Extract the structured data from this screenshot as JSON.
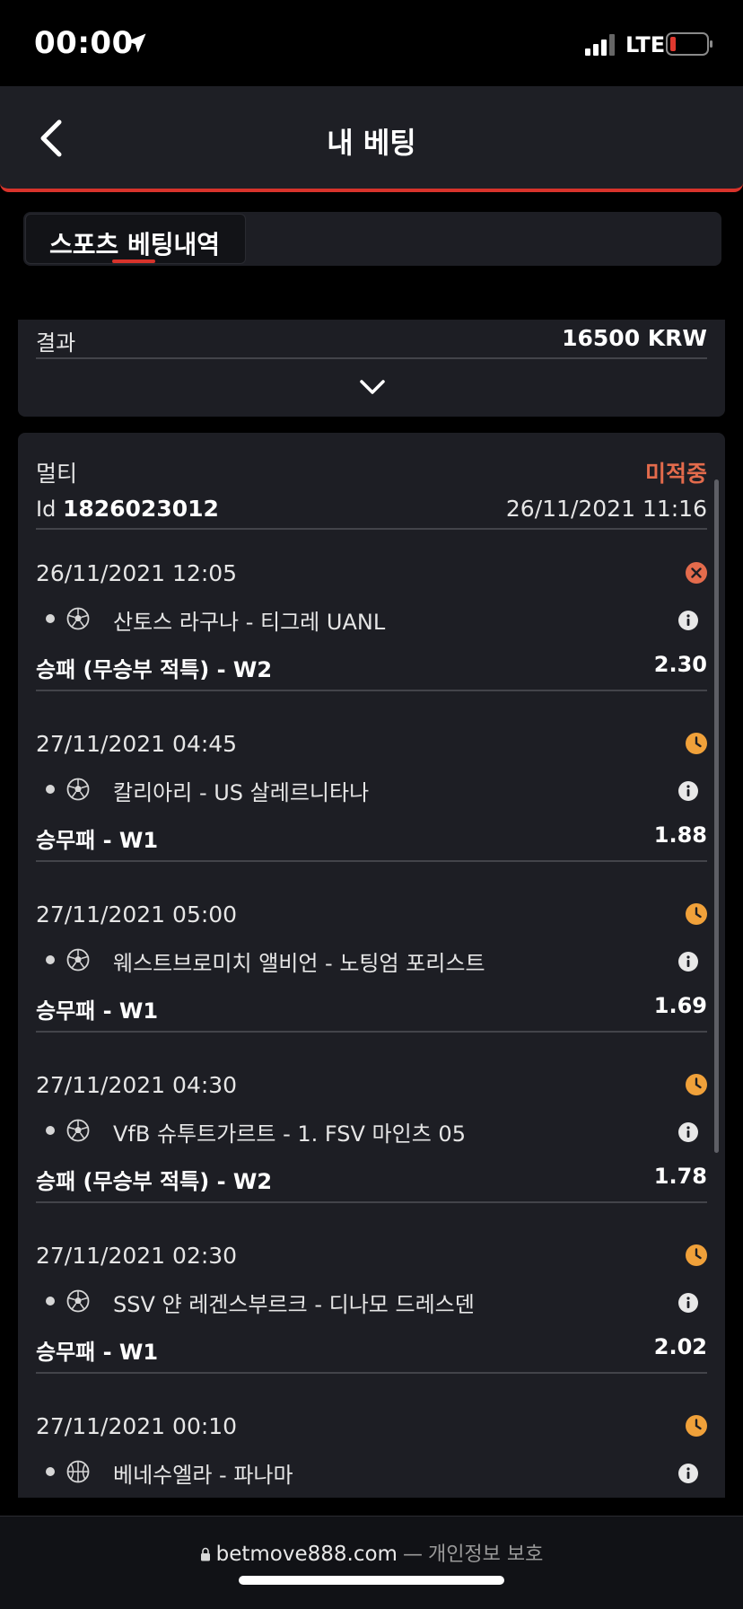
{
  "status_bar": {
    "time": "00:00",
    "network": "LTE",
    "icons": [
      "location-arrow-icon",
      "signal-icon",
      "battery-icon"
    ]
  },
  "header": {
    "title": "내 베팅",
    "icons": [
      "back-chevron-icon"
    ]
  },
  "tabs": [
    {
      "label": "스포츠 베팅내역",
      "active": true
    }
  ],
  "summary": {
    "label": "결과",
    "value": "16500 KRW",
    "icons": [
      "chevron-down-icon"
    ]
  },
  "bet": {
    "type": "멀티",
    "status": "미적중",
    "id_label": "Id",
    "id": "1826023012",
    "date": "26/11/2021 11:16",
    "events": [
      {
        "time": "26/11/2021 12:05",
        "status_icon": "lost-x-icon",
        "sport_icon": "soccer-ball-icon",
        "match": "산토스 라구나 - 티그레 UANL",
        "market": "승패 (무승부 적특) - W2",
        "odds": "2.30"
      },
      {
        "time": "27/11/2021 04:45",
        "status_icon": "pending-clock-icon",
        "sport_icon": "soccer-ball-icon",
        "match": "칼리아리 - US 살레르니타나",
        "market": "승무패 - W1",
        "odds": "1.88"
      },
      {
        "time": "27/11/2021 05:00",
        "status_icon": "pending-clock-icon",
        "sport_icon": "soccer-ball-icon",
        "match": "웨스트브로미치 앨비언 - 노팅엄 포리스트",
        "market": "승무패 - W1",
        "odds": "1.69"
      },
      {
        "time": "27/11/2021 04:30",
        "status_icon": "pending-clock-icon",
        "sport_icon": "soccer-ball-icon",
        "match": "VfB 슈투트가르트 - 1. FSV 마인츠 05",
        "market": "승패 (무승부 적특) - W2",
        "odds": "1.78"
      },
      {
        "time": "27/11/2021 02:30",
        "status_icon": "pending-clock-icon",
        "sport_icon": "soccer-ball-icon",
        "match": "SSV 얀 레겐스부르크 - 디나모 드레스덴",
        "market": "승무패 - W1",
        "odds": "2.02"
      },
      {
        "time": "27/11/2021 00:10",
        "status_icon": "pending-clock-icon",
        "sport_icon": "basketball-icon",
        "match": "베네수엘라 - 파나마",
        "market": "",
        "odds": ""
      }
    ]
  },
  "footer": {
    "domain": "betmove888.com",
    "separator": "—",
    "privacy": "개인정보 보호",
    "icons": [
      "lock-icon"
    ]
  },
  "colors": {
    "accent_red": "#d8332b",
    "lost": "#e36b4c",
    "pending": "#f0a13a",
    "card_bg": "#1d1e24"
  }
}
